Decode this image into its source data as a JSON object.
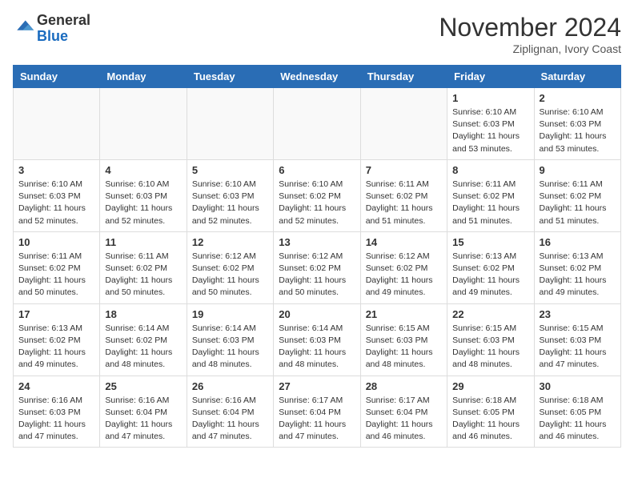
{
  "header": {
    "logo_general": "General",
    "logo_blue": "Blue",
    "month_title": "November 2024",
    "subtitle": "Ziplignan, Ivory Coast"
  },
  "days_of_week": [
    "Sunday",
    "Monday",
    "Tuesday",
    "Wednesday",
    "Thursday",
    "Friday",
    "Saturday"
  ],
  "weeks": [
    [
      {
        "day": "",
        "info": ""
      },
      {
        "day": "",
        "info": ""
      },
      {
        "day": "",
        "info": ""
      },
      {
        "day": "",
        "info": ""
      },
      {
        "day": "",
        "info": ""
      },
      {
        "day": "1",
        "info": "Sunrise: 6:10 AM\nSunset: 6:03 PM\nDaylight: 11 hours and 53 minutes."
      },
      {
        "day": "2",
        "info": "Sunrise: 6:10 AM\nSunset: 6:03 PM\nDaylight: 11 hours and 53 minutes."
      }
    ],
    [
      {
        "day": "3",
        "info": "Sunrise: 6:10 AM\nSunset: 6:03 PM\nDaylight: 11 hours and 52 minutes."
      },
      {
        "day": "4",
        "info": "Sunrise: 6:10 AM\nSunset: 6:03 PM\nDaylight: 11 hours and 52 minutes."
      },
      {
        "day": "5",
        "info": "Sunrise: 6:10 AM\nSunset: 6:03 PM\nDaylight: 11 hours and 52 minutes."
      },
      {
        "day": "6",
        "info": "Sunrise: 6:10 AM\nSunset: 6:02 PM\nDaylight: 11 hours and 52 minutes."
      },
      {
        "day": "7",
        "info": "Sunrise: 6:11 AM\nSunset: 6:02 PM\nDaylight: 11 hours and 51 minutes."
      },
      {
        "day": "8",
        "info": "Sunrise: 6:11 AM\nSunset: 6:02 PM\nDaylight: 11 hours and 51 minutes."
      },
      {
        "day": "9",
        "info": "Sunrise: 6:11 AM\nSunset: 6:02 PM\nDaylight: 11 hours and 51 minutes."
      }
    ],
    [
      {
        "day": "10",
        "info": "Sunrise: 6:11 AM\nSunset: 6:02 PM\nDaylight: 11 hours and 50 minutes."
      },
      {
        "day": "11",
        "info": "Sunrise: 6:11 AM\nSunset: 6:02 PM\nDaylight: 11 hours and 50 minutes."
      },
      {
        "day": "12",
        "info": "Sunrise: 6:12 AM\nSunset: 6:02 PM\nDaylight: 11 hours and 50 minutes."
      },
      {
        "day": "13",
        "info": "Sunrise: 6:12 AM\nSunset: 6:02 PM\nDaylight: 11 hours and 50 minutes."
      },
      {
        "day": "14",
        "info": "Sunrise: 6:12 AM\nSunset: 6:02 PM\nDaylight: 11 hours and 49 minutes."
      },
      {
        "day": "15",
        "info": "Sunrise: 6:13 AM\nSunset: 6:02 PM\nDaylight: 11 hours and 49 minutes."
      },
      {
        "day": "16",
        "info": "Sunrise: 6:13 AM\nSunset: 6:02 PM\nDaylight: 11 hours and 49 minutes."
      }
    ],
    [
      {
        "day": "17",
        "info": "Sunrise: 6:13 AM\nSunset: 6:02 PM\nDaylight: 11 hours and 49 minutes."
      },
      {
        "day": "18",
        "info": "Sunrise: 6:14 AM\nSunset: 6:02 PM\nDaylight: 11 hours and 48 minutes."
      },
      {
        "day": "19",
        "info": "Sunrise: 6:14 AM\nSunset: 6:03 PM\nDaylight: 11 hours and 48 minutes."
      },
      {
        "day": "20",
        "info": "Sunrise: 6:14 AM\nSunset: 6:03 PM\nDaylight: 11 hours and 48 minutes."
      },
      {
        "day": "21",
        "info": "Sunrise: 6:15 AM\nSunset: 6:03 PM\nDaylight: 11 hours and 48 minutes."
      },
      {
        "day": "22",
        "info": "Sunrise: 6:15 AM\nSunset: 6:03 PM\nDaylight: 11 hours and 48 minutes."
      },
      {
        "day": "23",
        "info": "Sunrise: 6:15 AM\nSunset: 6:03 PM\nDaylight: 11 hours and 47 minutes."
      }
    ],
    [
      {
        "day": "24",
        "info": "Sunrise: 6:16 AM\nSunset: 6:03 PM\nDaylight: 11 hours and 47 minutes."
      },
      {
        "day": "25",
        "info": "Sunrise: 6:16 AM\nSunset: 6:04 PM\nDaylight: 11 hours and 47 minutes."
      },
      {
        "day": "26",
        "info": "Sunrise: 6:16 AM\nSunset: 6:04 PM\nDaylight: 11 hours and 47 minutes."
      },
      {
        "day": "27",
        "info": "Sunrise: 6:17 AM\nSunset: 6:04 PM\nDaylight: 11 hours and 47 minutes."
      },
      {
        "day": "28",
        "info": "Sunrise: 6:17 AM\nSunset: 6:04 PM\nDaylight: 11 hours and 46 minutes."
      },
      {
        "day": "29",
        "info": "Sunrise: 6:18 AM\nSunset: 6:05 PM\nDaylight: 11 hours and 46 minutes."
      },
      {
        "day": "30",
        "info": "Sunrise: 6:18 AM\nSunset: 6:05 PM\nDaylight: 11 hours and 46 minutes."
      }
    ]
  ]
}
